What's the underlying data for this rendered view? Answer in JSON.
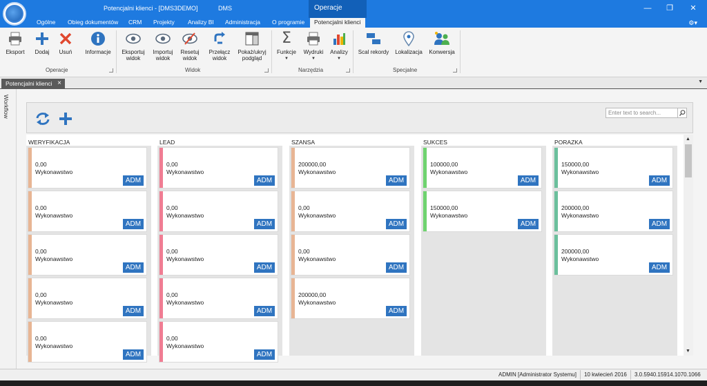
{
  "window": {
    "title": "Potencjalni klienci - [DMS3DEMO]",
    "app": "DMS",
    "context_tab": "Operacje"
  },
  "menu": {
    "tabs": [
      "Ogólne",
      "Obieg dokumentów",
      "CRM",
      "Projekty",
      "Analizy BI",
      "Administracja",
      "O programie",
      "Potencjalni klienci"
    ]
  },
  "ribbon": {
    "buttons": {
      "eksport": "Eksport",
      "dodaj": "Dodaj",
      "usun": "Usuń",
      "informacje": "Informacje",
      "eksportuj_widok_1": "Eksportuj",
      "eksportuj_widok_2": "widok",
      "importuj_widok_1": "Importuj",
      "importuj_widok_2": "widok",
      "resetuj_widok_1": "Resetuj",
      "resetuj_widok_2": "widok",
      "przelacz_widok_1": "Przełącz",
      "przelacz_widok_2": "widok",
      "pokaz_podglad_1": "Pokaż/ukryj",
      "pokaz_podglad_2": "podgląd",
      "funkcje": "Funkcje",
      "wydruki": "Wydruki",
      "analizy": "Analizy",
      "scal_rekordy": "Scal rekordy",
      "lokalizacja": "Lokalizacja",
      "konwersja": "Konwersja"
    },
    "groups": {
      "operacje": "Operacje",
      "widok": "Widok",
      "narzedzia": "Narzędzia",
      "specjalne": "Specjalne"
    }
  },
  "doc_tab": {
    "label": "Potencjalni klienci"
  },
  "side": {
    "label": "Workflow"
  },
  "search": {
    "placeholder": "Enter text to search..."
  },
  "colors": {
    "weryfikacja": "#e8b594",
    "lead": "#f07d93",
    "szansa": "#e8b594",
    "sukces": "#6fd36f",
    "porazka": "#6bbf9c",
    "adm": "#2f74c0",
    "titlebar": "#1e7ae0"
  },
  "board": {
    "columns": [
      {
        "title": "WERYFIKACJA",
        "cards": [
          {
            "value": "0,00",
            "label": "Wykonawstwo",
            "badge": "ADM"
          },
          {
            "value": "0,00",
            "label": "Wykonawstwo",
            "badge": "ADM"
          },
          {
            "value": "0,00",
            "label": "Wykonawstwo",
            "badge": "ADM"
          },
          {
            "value": "0,00",
            "label": "Wykonawstwo",
            "badge": "ADM"
          },
          {
            "value": "0,00",
            "label": "Wykonawstwo",
            "badge": "ADM"
          }
        ]
      },
      {
        "title": "LEAD",
        "cards": [
          {
            "value": "0,00",
            "label": "Wykonawstwo",
            "badge": "ADM"
          },
          {
            "value": "0,00",
            "label": "Wykonawstwo",
            "badge": "ADM"
          },
          {
            "value": "0,00",
            "label": "Wykonawstwo",
            "badge": "ADM"
          },
          {
            "value": "0,00",
            "label": "Wykonawstwo",
            "badge": "ADM"
          },
          {
            "value": "0,00",
            "label": "Wykonawstwo",
            "badge": "ADM"
          }
        ]
      },
      {
        "title": "SZANSA",
        "cards": [
          {
            "value": "200000,00",
            "label": "Wykonawstwo",
            "badge": "ADM"
          },
          {
            "value": "0,00",
            "label": "Wykonawstwo",
            "badge": "ADM"
          },
          {
            "value": "0,00",
            "label": "Wykonawstwo",
            "badge": "ADM"
          },
          {
            "value": "200000,00",
            "label": "Wykonawstwo",
            "badge": "ADM"
          }
        ]
      },
      {
        "title": "SUKCES",
        "cards": [
          {
            "value": "100000,00",
            "label": "Wykonawstwo",
            "badge": "ADM"
          },
          {
            "value": "150000,00",
            "label": "Wykonawstwo",
            "badge": "ADM"
          }
        ]
      },
      {
        "title": "PORAZKA",
        "cards": [
          {
            "value": "150000,00",
            "label": "Wykonawstwo",
            "badge": "ADM"
          },
          {
            "value": "200000,00",
            "label": "Wykonawstwo",
            "badge": "ADM"
          },
          {
            "value": "200000,00",
            "label": "Wykonawstwo",
            "badge": "ADM"
          }
        ]
      }
    ]
  },
  "status": {
    "user": "ADMIN [Administrator Systemu]",
    "date": "10 kwiecień 2016",
    "version": "3.0.5940.15914.1070.1066"
  }
}
